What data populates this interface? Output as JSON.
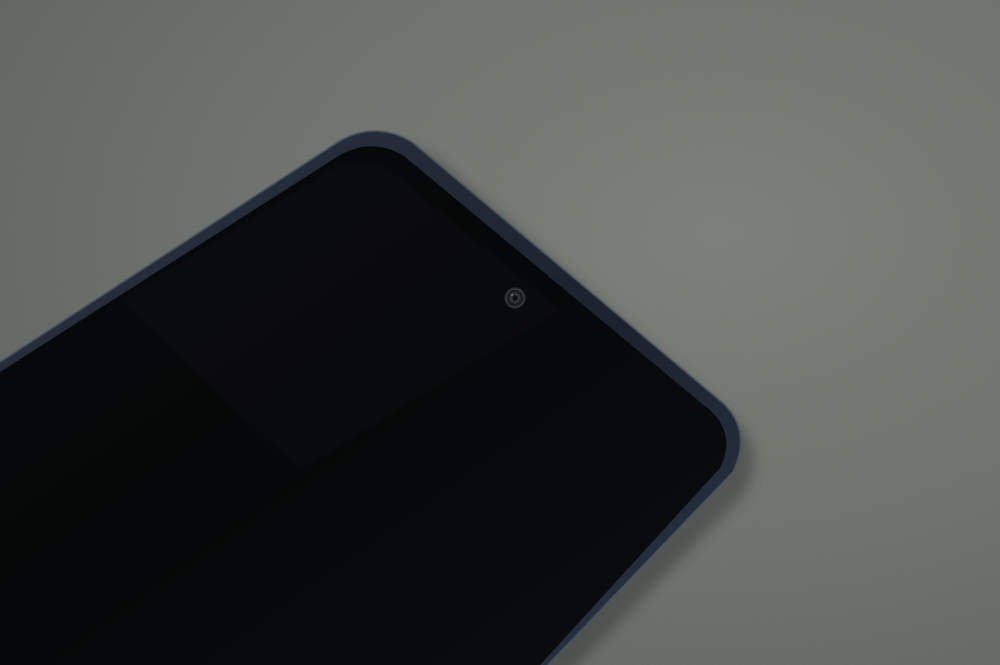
{
  "scene": {
    "subject": "smartphone",
    "colors": {
      "surface": "#6b6f69",
      "surface_light": "#7a7e77",
      "surface_dark": "#5c605a",
      "phone_frame": "#1b222d",
      "frame_highlight": "#4a5566",
      "screen": "#060708",
      "camera_lens": "#2e3236"
    },
    "elements": {
      "surface": "table-surface",
      "phone": "smartphone",
      "screen": "phone-screen",
      "camera": "front-camera-icon"
    }
  }
}
